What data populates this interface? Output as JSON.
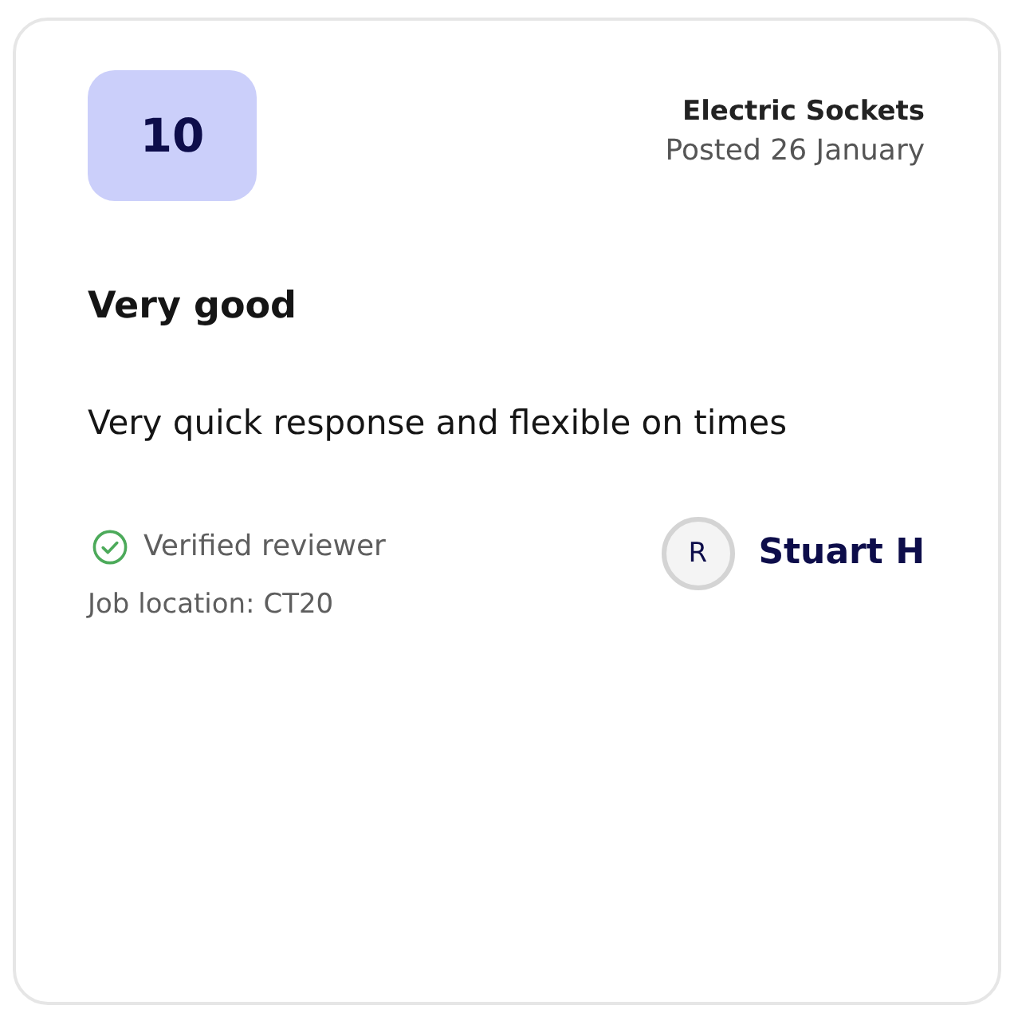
{
  "review": {
    "score": "10",
    "category": "Electric Sockets",
    "posted": "Posted 26 January",
    "title": "Very good",
    "body": "Very quick response and flexible on times"
  },
  "reviewer": {
    "verified": true,
    "verified_label": "Verified reviewer",
    "job_location": "Job location: CT20",
    "initial": "R",
    "name": "Stuart H"
  }
}
